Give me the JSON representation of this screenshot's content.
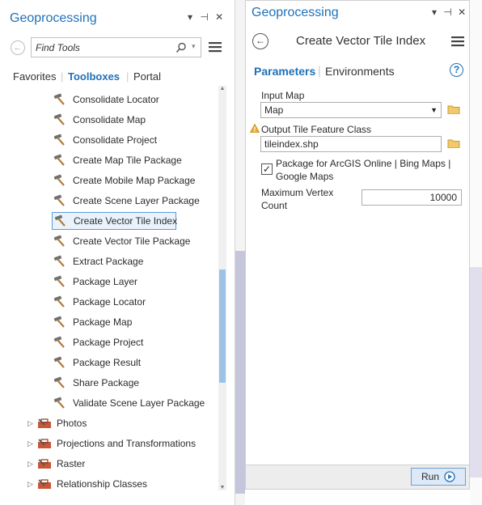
{
  "left": {
    "title": "Geoprocessing",
    "pin_controls": "▾ ⊣ ✕",
    "search_placeholder": "Find Tools",
    "tabs": [
      "Favorites",
      "Toolboxes",
      "Portal"
    ],
    "tools": [
      "Consolidate Locator",
      "Consolidate Map",
      "Consolidate Project",
      "Create Map Tile Package",
      "Create Mobile Map Package",
      "Create Scene Layer Package",
      "Create Vector Tile Index",
      "Create Vector Tile Package",
      "Extract Package",
      "Package Layer",
      "Package Locator",
      "Package Map",
      "Package Project",
      "Package Result",
      "Share Package",
      "Validate Scene Layer Package"
    ],
    "toolboxes": [
      "Photos",
      "Projections and Transformations",
      "Raster",
      "Relationship Classes"
    ],
    "scroll_position": 0.55
  },
  "right": {
    "title": "Geoprocessing",
    "tool_title": "Create Vector Tile Index",
    "tabs": [
      "Parameters",
      "Environments"
    ],
    "input_map_label": "Input Map",
    "input_map_value": "Map",
    "output_label": "Output Tile Feature Class",
    "output_value": "tileindex.shp",
    "checkbox_label_1": "Package for ArcGIS Online | Bing Maps |",
    "checkbox_label_2": "Google Maps",
    "checkbox_checked": true,
    "max_vertex_label_1": "Maximum Vertex",
    "max_vertex_label_2": "Count",
    "max_vertex_value": "10000",
    "run_label": "Run",
    "help_symbol": "?"
  },
  "colors": {
    "accent": "#1f70b8",
    "selected_bg": "#eaf3fc",
    "selected_border": "#5b9bd5",
    "scroll_thumb": "#9cc3e6"
  }
}
